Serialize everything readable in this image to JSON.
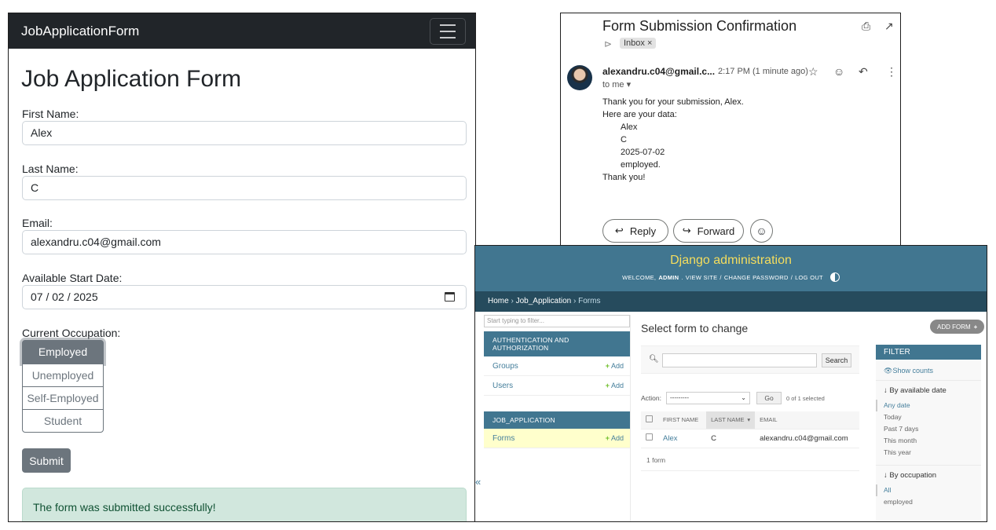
{
  "form_app": {
    "brand": "JobApplicationForm",
    "title": "Job Application Form",
    "fields": {
      "first_name": {
        "label": "First Name:",
        "value": "Alex"
      },
      "last_name": {
        "label": "Last Name:",
        "value": "C"
      },
      "email": {
        "label": "Email:",
        "value": "alexandru.c04@gmail.com"
      },
      "start_date": {
        "label": "Available Start Date:",
        "value": "07 / 02 / 2025"
      }
    },
    "occupation": {
      "label": "Current Occupation:",
      "options": [
        "Employed",
        "Unemployed",
        "Self-Employed",
        "Student"
      ],
      "selected": "Employed"
    },
    "submit_label": "Submit",
    "success_message": "The form was submitted successfully!"
  },
  "email": {
    "subject": "Form Submission Confirmation",
    "inbox_chip": "Inbox ×",
    "sender": "alexandru.c04@gmail.c...",
    "time": "2:17 PM (1 minute ago)",
    "to": "to me ▾",
    "body": {
      "line1": "Thank you for your submission, Alex.",
      "line2": "Here are your data:",
      "d1": "Alex",
      "d2": "C",
      "d3": "2025-07-02",
      "d4": "employed.",
      "line3": "Thank you!"
    },
    "reply_label": "Reply",
    "forward_label": "Forward"
  },
  "admin": {
    "site_title": "Django administration",
    "welcome": "WELCOME,",
    "user": "ADMIN",
    "view_site": "VIEW SITE",
    "change_password": "CHANGE PASSWORD",
    "logout": "LOG OUT",
    "sep": "/",
    "breadcrumbs": {
      "home": "Home",
      "app": "Job_Application",
      "model": "Forms",
      "sep": "›"
    },
    "nav_filter_placeholder": "Start typing to filter...",
    "auth_caption": "AUTHENTICATION AND AUTHORIZATION",
    "groups": "Groups",
    "users": "Users",
    "app_caption": "JOB_APPLICATION",
    "forms": "Forms",
    "add": "Add",
    "collapse": "«",
    "page_title": "Select form to change",
    "add_form": "ADD FORM",
    "search_btn": "Search",
    "action_label": "Action:",
    "action_value": "---------",
    "go": "Go",
    "selected_count": "0 of 1 selected",
    "columns": [
      "FIRST NAME",
      "LAST NAME",
      "EMAIL"
    ],
    "row": {
      "first_name": "Alex",
      "last_name": "C",
      "email": "alexandru.c04@gmail.com"
    },
    "result_count": "1 form",
    "filter": {
      "title": "FILTER",
      "show_counts": "Show counts",
      "by_date": "↓ By available date",
      "date_options": [
        "Any date",
        "Today",
        "Past 7 days",
        "This month",
        "This year"
      ],
      "by_occupation": "↓ By occupation",
      "occupation_options": [
        "All",
        "employed"
      ]
    }
  }
}
